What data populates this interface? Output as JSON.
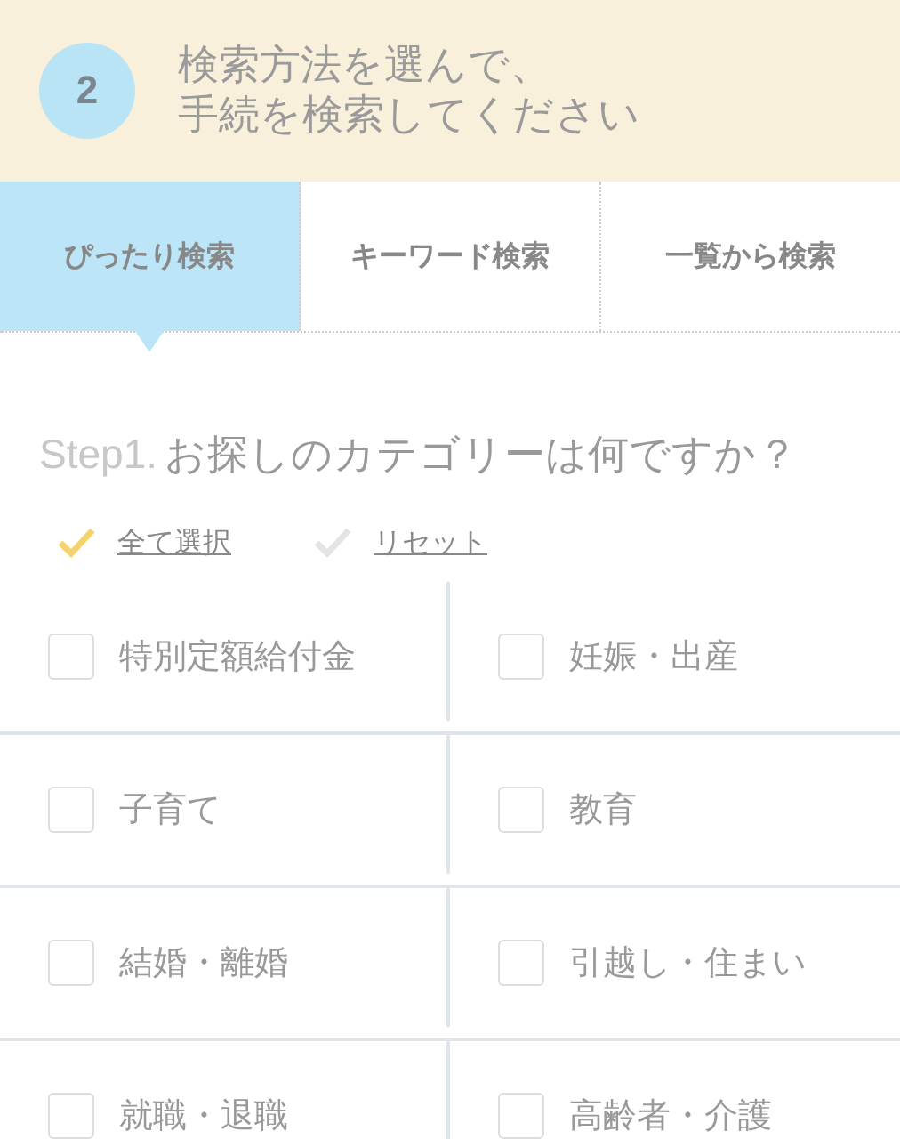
{
  "header": {
    "step_number": "2",
    "title_lines": [
      "検索方法を選んで、",
      "手続を検索してください"
    ]
  },
  "tabs": [
    {
      "label": "ぴったり検索",
      "selected": true
    },
    {
      "label": "キーワード検索",
      "selected": false
    },
    {
      "label": "一覧から検索",
      "selected": false
    }
  ],
  "question": {
    "step_label": "Step1.",
    "text": "お探しのカテゴリーは何ですか？"
  },
  "actions": [
    {
      "label": "全て選択",
      "color": "#f5d36a"
    },
    {
      "label": "リセット",
      "color": "#e4e4e4"
    }
  ],
  "categories": [
    {
      "label": "特別定額給付金",
      "checked": false
    },
    {
      "label": "妊娠・出産",
      "checked": false
    },
    {
      "label": "子育て",
      "checked": false
    },
    {
      "label": "教育",
      "checked": false
    },
    {
      "label": "結婚・離婚",
      "checked": false
    },
    {
      "label": "引越し・住まい",
      "checked": false
    },
    {
      "label": "就職・退職",
      "checked": false
    },
    {
      "label": "高齢者・介護",
      "checked": false
    }
  ]
}
